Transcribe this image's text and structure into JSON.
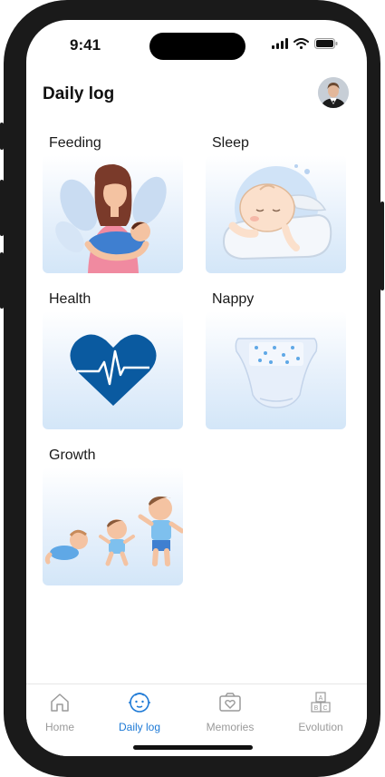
{
  "status": {
    "time": "9:41"
  },
  "header": {
    "title": "Daily log"
  },
  "cards": [
    {
      "label": "Feeding"
    },
    {
      "label": "Sleep"
    },
    {
      "label": "Health"
    },
    {
      "label": "Nappy"
    },
    {
      "label": "Growth"
    }
  ],
  "tabbar": {
    "tabs": [
      {
        "label": "Home",
        "icon": "house-icon"
      },
      {
        "label": "Daily log",
        "icon": "baby-face-icon",
        "active": true
      },
      {
        "label": "Memories",
        "icon": "photo-heart-icon"
      },
      {
        "label": "Evolution",
        "icon": "abc-blocks-icon"
      }
    ]
  },
  "colors": {
    "accent": "#1e7ad6",
    "heart": "#0a5aa0",
    "card_gradient_bottom": "#d3e6f8",
    "inactive_tab": "#9a9a9a"
  }
}
